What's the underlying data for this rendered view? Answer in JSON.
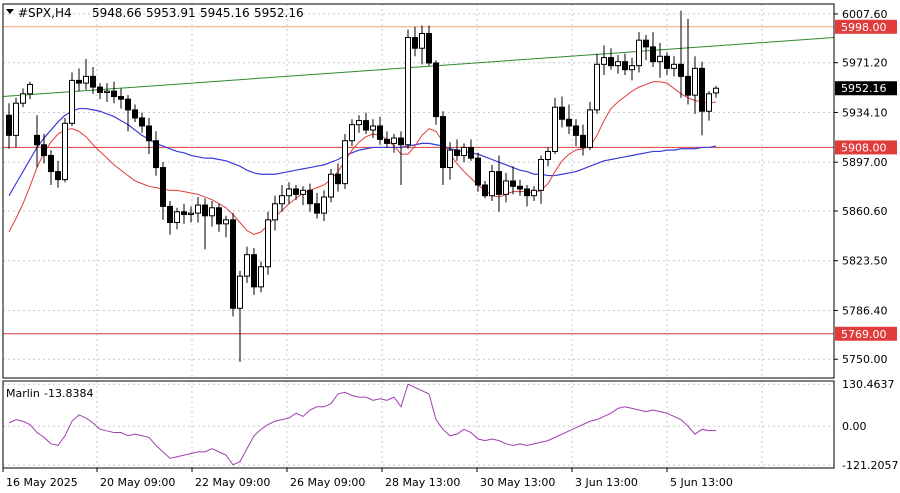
{
  "header": {
    "symbol": "#SPX,H4",
    "open": "5948.66",
    "high": "5953.91",
    "low": "5945.16",
    "close": "5952.16"
  },
  "indicator": {
    "label": "Marlin",
    "value": "-13.8384",
    "ticks": [
      "130.4637",
      "0.00",
      "-121.2057"
    ]
  },
  "x_axis": {
    "ticks": [
      "16 May 2025",
      "20 May 09:00",
      "22 May 09:00",
      "26 May 09:00",
      "28 May 13:00",
      "30 May 13:00",
      "3 Jun 13:00",
      "5 Jun 13:00"
    ]
  },
  "colors": {
    "background": "#ffffff",
    "grid": "#c8c8c8",
    "bull_candle": "#ffffff",
    "bear_candle": "#000000",
    "sma_slow": "#3b3bd8",
    "sma_fast": "#e03c3c",
    "trendline": "#2e8b2e",
    "level_line": "#e03c3c",
    "level_line_top": "#f4a07a",
    "marlin": "#a040b0",
    "price_tag": "#000000"
  },
  "chart_data": [
    {
      "type": "candlestick",
      "title": "#SPX,H4",
      "ylim": [
        5736,
        6015
      ],
      "y_ticks": [
        "6007.60",
        "5971.20",
        "5934.10",
        "5897.00",
        "5860.60",
        "5823.50",
        "5786.40",
        "5750.00"
      ],
      "current_price": "5952.16",
      "levels": [
        {
          "value": 5998.0,
          "label": "5998.00"
        },
        {
          "value": 5908.0,
          "label": "5908.00"
        },
        {
          "value": 5769.0,
          "label": "5769.00"
        }
      ],
      "trendline": {
        "start": 5946,
        "end": 5990
      },
      "candles": [
        [
          5932,
          5941,
          5907,
          5917
        ],
        [
          5917,
          5945,
          5908,
          5941
        ],
        [
          5941,
          5952,
          5938,
          5948
        ],
        [
          5948,
          5957,
          5944,
          5955
        ],
        [
          5917,
          5932,
          5893,
          5910
        ],
        [
          5910,
          5918,
          5896,
          5902
        ],
        [
          5902,
          5906,
          5880,
          5890
        ],
        [
          5890,
          5898,
          5878,
          5884
        ],
        [
          5884,
          5930,
          5882,
          5926
        ],
        [
          5926,
          5964,
          5924,
          5958
        ],
        [
          5958,
          5967,
          5950,
          5956
        ],
        [
          5956,
          5974,
          5951,
          5961
        ],
        [
          5961,
          5968,
          5948,
          5953
        ],
        [
          5953,
          5956,
          5944,
          5949
        ],
        [
          5949,
          5956,
          5942,
          5950
        ],
        [
          5950,
          5957,
          5941,
          5946
        ],
        [
          5946,
          5952,
          5937,
          5944
        ],
        [
          5944,
          5947,
          5920,
          5936
        ],
        [
          5936,
          5940,
          5927,
          5930
        ],
        [
          5930,
          5934,
          5919,
          5924
        ],
        [
          5924,
          5930,
          5903,
          5913
        ],
        [
          5913,
          5920,
          5887,
          5893
        ],
        [
          5893,
          5897,
          5854,
          5864
        ],
        [
          5864,
          5868,
          5843,
          5852
        ],
        [
          5852,
          5863,
          5847,
          5860
        ],
        [
          5860,
          5866,
          5851,
          5858
        ],
        [
          5858,
          5864,
          5852,
          5859
        ],
        [
          5859,
          5871,
          5852,
          5865
        ],
        [
          5865,
          5870,
          5832,
          5857
        ],
        [
          5857,
          5868,
          5849,
          5863
        ],
        [
          5863,
          5866,
          5845,
          5851
        ],
        [
          5851,
          5857,
          5841,
          5854
        ],
        [
          5854,
          5859,
          5782,
          5788
        ],
        [
          5788,
          5816,
          5748,
          5812
        ],
        [
          5812,
          5834,
          5807,
          5828
        ],
        [
          5828,
          5833,
          5798,
          5804
        ],
        [
          5804,
          5823,
          5800,
          5819
        ],
        [
          5819,
          5860,
          5813,
          5854
        ],
        [
          5854,
          5872,
          5846,
          5866
        ],
        [
          5866,
          5880,
          5860,
          5872
        ],
        [
          5872,
          5882,
          5866,
          5877
        ],
        [
          5877,
          5880,
          5869,
          5873
        ],
        [
          5873,
          5879,
          5865,
          5876
        ],
        [
          5876,
          5881,
          5860,
          5866
        ],
        [
          5866,
          5874,
          5855,
          5859
        ],
        [
          5859,
          5876,
          5853,
          5871
        ],
        [
          5871,
          5892,
          5867,
          5888
        ],
        [
          5888,
          5896,
          5875,
          5881
        ],
        [
          5881,
          5918,
          5877,
          5913
        ],
        [
          5913,
          5929,
          5909,
          5925
        ],
        [
          5925,
          5932,
          5919,
          5928
        ],
        [
          5928,
          5934,
          5918,
          5921
        ],
        [
          5921,
          5929,
          5915,
          5924
        ],
        [
          5924,
          5931,
          5910,
          5914
        ],
        [
          5914,
          5920,
          5908,
          5911
        ],
        [
          5911,
          5918,
          5904,
          5915
        ],
        [
          5915,
          5920,
          5880,
          5910
        ],
        [
          5910,
          5996,
          5907,
          5990
        ],
        [
          5990,
          5998,
          5976,
          5982
        ],
        [
          5982,
          5999,
          5970,
          5993
        ],
        [
          5993,
          5999,
          5969,
          5971
        ],
        [
          5971,
          5973,
          5925,
          5931
        ],
        [
          5931,
          5935,
          5880,
          5893
        ],
        [
          5893,
          5912,
          5884,
          5906
        ],
        [
          5906,
          5914,
          5898,
          5902
        ],
        [
          5902,
          5911,
          5897,
          5908
        ],
        [
          5908,
          5914,
          5898,
          5900
        ],
        [
          5900,
          5904,
          5875,
          5880
        ],
        [
          5880,
          5883,
          5870,
          5872
        ],
        [
          5872,
          5895,
          5868,
          5890
        ],
        [
          5890,
          5902,
          5860,
          5873
        ],
        [
          5873,
          5889,
          5867,
          5883
        ],
        [
          5883,
          5894,
          5873,
          5879
        ],
        [
          5879,
          5884,
          5872,
          5877
        ],
        [
          5877,
          5880,
          5864,
          5872
        ],
        [
          5872,
          5879,
          5868,
          5876
        ],
        [
          5876,
          5902,
          5866,
          5899
        ],
        [
          5899,
          5908,
          5894,
          5905
        ],
        [
          5905,
          5945,
          5903,
          5938
        ],
        [
          5938,
          5946,
          5923,
          5929
        ],
        [
          5929,
          5940,
          5918,
          5924
        ],
        [
          5924,
          5929,
          5909,
          5917
        ],
        [
          5917,
          5925,
          5902,
          5908
        ],
        [
          5908,
          5942,
          5906,
          5936
        ],
        [
          5936,
          5978,
          5933,
          5970
        ],
        [
          5970,
          5984,
          5962,
          5975
        ],
        [
          5975,
          5982,
          5966,
          5969
        ],
        [
          5969,
          5977,
          5963,
          5972
        ],
        [
          5972,
          5978,
          5962,
          5966
        ],
        [
          5966,
          5975,
          5958,
          5969
        ],
        [
          5969,
          5994,
          5964,
          5988
        ],
        [
          5988,
          5992,
          5973,
          5983
        ],
        [
          5983,
          5994,
          5968,
          5972
        ],
        [
          5972,
          5986,
          5960,
          5976
        ],
        [
          5976,
          5979,
          5962,
          5967
        ],
        [
          5967,
          5976,
          5961,
          5970
        ],
        [
          5970,
          6010,
          5945,
          5961
        ],
        [
          5961,
          6004,
          5940,
          5947
        ],
        [
          5947,
          5976,
          5933,
          5967
        ],
        [
          5967,
          5972,
          5917,
          5935
        ],
        [
          5935,
          5950,
          5928,
          5948
        ],
        [
          5948.66,
          5953.91,
          5945.16,
          5952.16
        ]
      ],
      "sma_slow": [
        5872,
        5881,
        5890,
        5899,
        5908,
        5915,
        5921,
        5927,
        5932,
        5935,
        5937,
        5937,
        5936,
        5935,
        5933,
        5931,
        5928,
        5925,
        5921,
        5917,
        5914,
        5911,
        5909,
        5907,
        5905,
        5904,
        5902,
        5901,
        5900,
        5900,
        5899,
        5898,
        5896,
        5894,
        5891,
        5889,
        5888,
        5888,
        5888,
        5889,
        5890,
        5891,
        5892,
        5893,
        5894,
        5895,
        5897,
        5899,
        5902,
        5904,
        5906,
        5907,
        5908,
        5908,
        5908,
        5908,
        5908,
        5909,
        5910,
        5911,
        5911,
        5910,
        5909,
        5907,
        5906,
        5905,
        5904,
        5903,
        5901,
        5899,
        5897,
        5895,
        5893,
        5891,
        5890,
        5888,
        5888,
        5887,
        5887,
        5888,
        5889,
        5890,
        5892,
        5894,
        5896,
        5898,
        5899,
        5900,
        5901,
        5902,
        5903,
        5904,
        5905,
        5905,
        5906,
        5906,
        5907,
        5907,
        5907,
        5908,
        5908,
        5909
      ],
      "sma_fast": [
        5845,
        5855,
        5866,
        5879,
        5893,
        5904,
        5912,
        5918,
        5921,
        5922,
        5920,
        5916,
        5910,
        5905,
        5900,
        5895,
        5891,
        5887,
        5883,
        5881,
        5879,
        5878,
        5877,
        5876,
        5876,
        5875,
        5874,
        5873,
        5871,
        5869,
        5866,
        5863,
        5858,
        5852,
        5846,
        5843,
        5845,
        5850,
        5856,
        5861,
        5866,
        5870,
        5874,
        5876,
        5878,
        5880,
        5884,
        5890,
        5898,
        5906,
        5912,
        5916,
        5918,
        5917,
        5914,
        5909,
        5903,
        5903,
        5909,
        5917,
        5922,
        5920,
        5912,
        5903,
        5896,
        5890,
        5885,
        5880,
        5876,
        5872,
        5871,
        5873,
        5875,
        5875,
        5875,
        5874,
        5876,
        5881,
        5890,
        5898,
        5903,
        5906,
        5907,
        5909,
        5917,
        5928,
        5937,
        5942,
        5946,
        5950,
        5953,
        5955,
        5957,
        5957,
        5956,
        5952,
        5948,
        5945,
        5943,
        5942,
        5941,
        5942
      ]
    },
    {
      "type": "line",
      "title": "Marlin -13.8384",
      "ylim": [
        -130,
        140
      ],
      "series": [
        {
          "name": "Marlin",
          "values": [
            10,
            20,
            15,
            5,
            -20,
            -35,
            -55,
            -60,
            -30,
            15,
            35,
            25,
            10,
            -10,
            -15,
            -20,
            -20,
            -30,
            -25,
            -30,
            -35,
            -60,
            -80,
            -100,
            -95,
            -90,
            -85,
            -80,
            -80,
            -70,
            -80,
            -90,
            -120,
            -110,
            -70,
            -30,
            -10,
            5,
            15,
            20,
            25,
            40,
            30,
            50,
            60,
            60,
            70,
            100,
            105,
            95,
            90,
            90,
            80,
            85,
            80,
            90,
            60,
            130,
            120,
            110,
            100,
            20,
            -10,
            -30,
            -25,
            -10,
            -20,
            -40,
            -45,
            -40,
            -45,
            -55,
            -60,
            -55,
            -60,
            -55,
            -50,
            -45,
            -35,
            -25,
            -15,
            -5,
            5,
            15,
            20,
            30,
            40,
            55,
            60,
            55,
            50,
            45,
            50,
            45,
            40,
            30,
            20,
            0,
            -25,
            -10,
            -14,
            -13.84
          ]
        }
      ]
    }
  ]
}
